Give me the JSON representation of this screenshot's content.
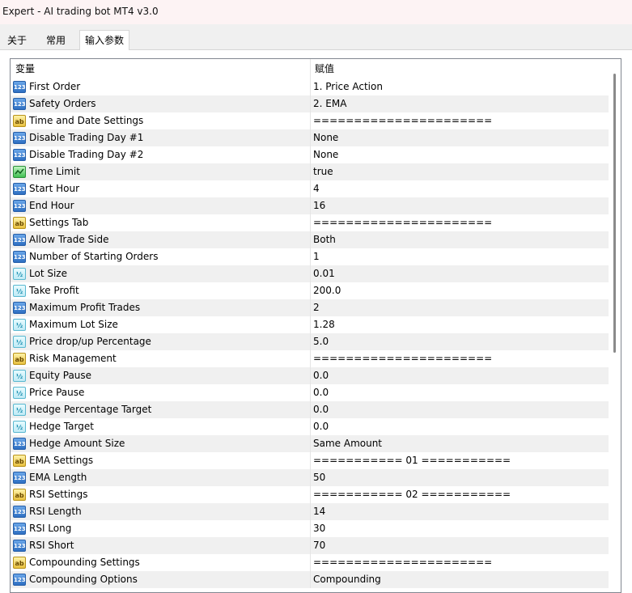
{
  "window": {
    "title": "Expert - AI trading bot MT4 v3.0"
  },
  "tabs": [
    {
      "label": "关于"
    },
    {
      "label": "常用"
    },
    {
      "label": "输入参数"
    }
  ],
  "table": {
    "headers": {
      "name": "变量",
      "value": "赋值"
    },
    "rows": [
      {
        "type": "int",
        "icon_text": "123",
        "name": "First Order",
        "value": "1. Price Action"
      },
      {
        "type": "int",
        "icon_text": "123",
        "name": "Safety Orders",
        "value": "2. EMA"
      },
      {
        "type": "string",
        "icon_text": "ab",
        "name": "Time and Date Settings",
        "value": "======================"
      },
      {
        "type": "int",
        "icon_text": "123",
        "name": "Disable Trading Day #1",
        "value": "None"
      },
      {
        "type": "int",
        "icon_text": "123",
        "name": "Disable Trading Day #2",
        "value": "None"
      },
      {
        "type": "bool",
        "icon_text": "",
        "name": "Time Limit",
        "value": "true"
      },
      {
        "type": "int",
        "icon_text": "123",
        "name": "Start Hour",
        "value": "4"
      },
      {
        "type": "int",
        "icon_text": "123",
        "name": "End Hour",
        "value": "16"
      },
      {
        "type": "string",
        "icon_text": "ab",
        "name": "Settings Tab",
        "value": "======================"
      },
      {
        "type": "int",
        "icon_text": "123",
        "name": "Allow Trade Side",
        "value": "Both"
      },
      {
        "type": "int",
        "icon_text": "123",
        "name": "Number of Starting Orders",
        "value": "1"
      },
      {
        "type": "double",
        "icon_text": "½",
        "name": "Lot Size",
        "value": "0.01"
      },
      {
        "type": "double",
        "icon_text": "½",
        "name": "Take Profit",
        "value": "200.0"
      },
      {
        "type": "int",
        "icon_text": "123",
        "name": "Maximum Profit Trades",
        "value": "2"
      },
      {
        "type": "double",
        "icon_text": "½",
        "name": "Maximum Lot Size",
        "value": "1.28"
      },
      {
        "type": "double",
        "icon_text": "½",
        "name": "Price drop/up Percentage",
        "value": "5.0"
      },
      {
        "type": "string",
        "icon_text": "ab",
        "name": "Risk Management",
        "value": "======================"
      },
      {
        "type": "double",
        "icon_text": "½",
        "name": "Equity Pause",
        "value": "0.0"
      },
      {
        "type": "double",
        "icon_text": "½",
        "name": "Price Pause",
        "value": "0.0"
      },
      {
        "type": "double",
        "icon_text": "½",
        "name": "Hedge Percentage Target",
        "value": "0.0"
      },
      {
        "type": "double",
        "icon_text": "½",
        "name": "Hedge Target",
        "value": "0.0"
      },
      {
        "type": "int",
        "icon_text": "123",
        "name": "Hedge Amount Size",
        "value": "Same Amount"
      },
      {
        "type": "string",
        "icon_text": "ab",
        "name": "EMA Settings",
        "value": "=========== 01 ==========="
      },
      {
        "type": "int",
        "icon_text": "123",
        "name": "EMA Length",
        "value": "50"
      },
      {
        "type": "string",
        "icon_text": "ab",
        "name": "RSI Settings",
        "value": "=========== 02 ==========="
      },
      {
        "type": "int",
        "icon_text": "123",
        "name": "RSI Length",
        "value": "14"
      },
      {
        "type": "int",
        "icon_text": "123",
        "name": "RSI Long",
        "value": "30"
      },
      {
        "type": "int",
        "icon_text": "123",
        "name": "RSI Short",
        "value": "70"
      },
      {
        "type": "string",
        "icon_text": "ab",
        "name": "Compounding Settings",
        "value": "======================"
      },
      {
        "type": "int",
        "icon_text": "123",
        "name": "Compounding Options",
        "value": "Compounding"
      }
    ]
  }
}
